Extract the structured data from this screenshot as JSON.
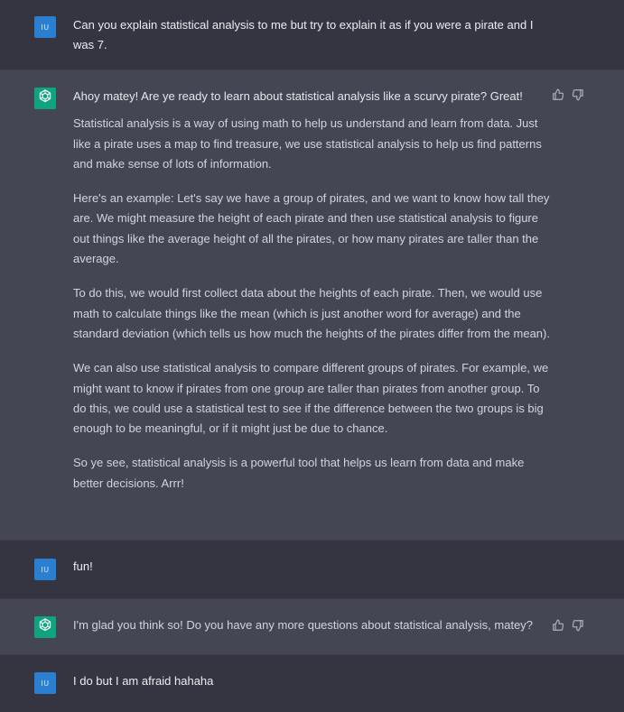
{
  "conversation": {
    "user_avatar_initials": "IU",
    "turn1": {
      "text": "Can you explain statistical analysis to me but try to explain it as if you were a pirate and I was 7."
    },
    "turn2": {
      "first_line": "Ahoy matey! Are ye ready to learn about statistical analysis like a scurvy pirate? Great!",
      "paragraphs": [
        "Statistical analysis is a way of using math to help us understand and learn from data. Just like a pirate uses a map to find treasure, we use statistical analysis to help us find patterns and make sense of lots of information.",
        "Here's an example: Let's say we have a group of pirates, and we want to know how tall they are. We might measure the height of each pirate and then use statistical analysis to figure out things like the average height of all the pirates, or how many pirates are taller than the average.",
        "To do this, we would first collect data about the heights of each pirate. Then, we would use math to calculate things like the mean (which is just another word for average) and the standard deviation (which tells us how much the heights of the pirates differ from the mean).",
        "We can also use statistical analysis to compare different groups of pirates. For example, we might want to know if pirates from one group are taller than pirates from another group. To do this, we could use a statistical test to see if the difference between the two groups is big enough to be meaningful, or if it might just be due to chance.",
        "So ye see, statistical analysis is a powerful tool that helps us learn from data and make better decisions. Arrr!"
      ]
    },
    "turn3": {
      "text": "fun!"
    },
    "turn4": {
      "text": "I'm glad you think so! Do you have any more questions about statistical analysis, matey?"
    },
    "turn5": {
      "text": "I do but I am afraid hahaha"
    }
  },
  "icons": {
    "assistant_avatar": "openai-logo-icon",
    "thumbs_up": "thumbs-up-icon",
    "thumbs_down": "thumbs-down-icon"
  },
  "colors": {
    "background_user": "#343541",
    "background_assistant": "#444654",
    "user_avatar": "#2a7fd1",
    "assistant_avatar": "#10a37f"
  }
}
